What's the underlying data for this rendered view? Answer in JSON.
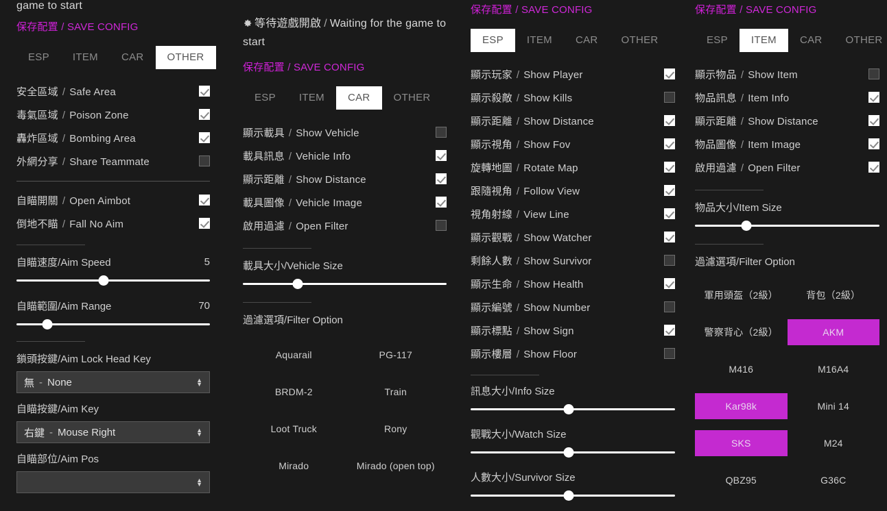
{
  "theme": {
    "background": "#1a1a1a",
    "accent": "#c42ad0",
    "save_link": "#cf28d8",
    "text": "#cfcfcf",
    "tab_active_bg": "#ffffff"
  },
  "status": {
    "cn": "等待遊戲開啟",
    "sep": "/",
    "en": "Waiting for the game to start",
    "icon": "gear-icon",
    "truncated_text": "game to start"
  },
  "save_config": {
    "cn": "保存配置",
    "sep": "/",
    "en": "SAVE CONFIG"
  },
  "tab_labels": [
    "ESP",
    "ITEM",
    "CAR",
    "OTHER"
  ],
  "panels": [
    {
      "id": "other-panel",
      "active_tab": "OTHER",
      "toggles": [
        {
          "cn": "安全區域",
          "en": "Safe Area",
          "checked": true
        },
        {
          "cn": "毒氣區域",
          "en": "Poison Zone",
          "checked": true
        },
        {
          "cn": "轟炸區域",
          "en": "Bombing Area",
          "checked": true
        },
        {
          "cn": "外網分享",
          "en": "Share Teammate",
          "checked": false
        }
      ],
      "toggles2": [
        {
          "cn": "自瞄開關",
          "en": "Open Aimbot",
          "checked": true
        },
        {
          "cn": "倒地不瞄",
          "en": "Fall No Aim",
          "checked": true
        }
      ],
      "sliders": [
        {
          "cn": "自瞄速度",
          "en": "Aim Speed",
          "value": "5",
          "percent": 45
        },
        {
          "cn": "自瞄範圍",
          "en": "Aim Range",
          "value": "70",
          "percent": 16
        }
      ],
      "selects": [
        {
          "label_cn": "鎖頭按鍵",
          "label_en": "Aim Lock Head Key",
          "value_cn": "無",
          "value_en": "None"
        },
        {
          "label_cn": "自瞄按鍵",
          "label_en": "Aim Key",
          "value_cn": "右鍵",
          "value_en": "Mouse Right"
        },
        {
          "label_cn": "自瞄部位",
          "label_en": "Aim Pos",
          "value_cn": "",
          "value_en": ""
        }
      ]
    },
    {
      "id": "car-panel",
      "active_tab": "CAR",
      "toggles": [
        {
          "cn": "顯示載具",
          "en": "Show Vehicle",
          "checked": false
        },
        {
          "cn": "載具訊息",
          "en": "Vehicle Info",
          "checked": true
        },
        {
          "cn": "顯示距離",
          "en": "Show Distance",
          "checked": true
        },
        {
          "cn": "載具圖像",
          "en": "Vehicle Image",
          "checked": true
        },
        {
          "cn": "啟用過濾",
          "en": "Open Filter",
          "checked": false
        }
      ],
      "size_slider": {
        "cn": "載具大小",
        "en": "Vehicle Size",
        "percent": 27
      },
      "filter_title": {
        "cn": "過濾選項",
        "en": "Filter Option"
      },
      "filter_items": [
        {
          "label": "Aquarail",
          "selected": false
        },
        {
          "label": "PG-117",
          "selected": false
        },
        {
          "label": "BRDM-2",
          "selected": false
        },
        {
          "label": "Train",
          "selected": false
        },
        {
          "label": "Loot Truck",
          "selected": false
        },
        {
          "label": "Rony",
          "selected": false
        },
        {
          "label": "Mirado",
          "selected": false
        },
        {
          "label": "Mirado (open top)",
          "selected": false
        }
      ]
    },
    {
      "id": "esp-panel",
      "active_tab": "ESP",
      "toggles": [
        {
          "cn": "顯示玩家",
          "en": "Show Player",
          "checked": true
        },
        {
          "cn": "顯示殺敵",
          "en": "Show Kills",
          "checked": false
        },
        {
          "cn": "顯示距離",
          "en": "Show Distance",
          "checked": true
        },
        {
          "cn": "顯示視角",
          "en": "Show Fov",
          "checked": true
        },
        {
          "cn": "旋轉地圖",
          "en": "Rotate Map",
          "checked": true
        },
        {
          "cn": "跟隨視角",
          "en": "Follow View",
          "checked": true
        },
        {
          "cn": "視角射線",
          "en": "View Line",
          "checked": true
        },
        {
          "cn": "顯示觀戰",
          "en": "Show Watcher",
          "checked": true
        },
        {
          "cn": "剩餘人數",
          "en": "Show Survivor",
          "checked": false
        },
        {
          "cn": "顯示生命",
          "en": "Show Health",
          "checked": true
        },
        {
          "cn": "顯示編號",
          "en": "Show Number",
          "checked": false
        },
        {
          "cn": "顯示標點",
          "en": "Show Sign",
          "checked": true
        },
        {
          "cn": "顯示樓層",
          "en": "Show Floor",
          "checked": false
        }
      ],
      "sliders": [
        {
          "cn": "訊息大小",
          "en": "Info Size",
          "percent": 48
        },
        {
          "cn": "觀戰大小",
          "en": "Watch Size",
          "percent": 48
        },
        {
          "cn": "人數大小",
          "en": "Survivor Size",
          "percent": 48
        }
      ]
    },
    {
      "id": "item-panel",
      "active_tab": "ITEM",
      "toggles": [
        {
          "cn": "顯示物品",
          "en": "Show Item",
          "checked": false
        },
        {
          "cn": "物品訊息",
          "en": "Item Info",
          "checked": true
        },
        {
          "cn": "顯示距離",
          "en": "Show Distance",
          "checked": true
        },
        {
          "cn": "物品圖像",
          "en": "Item Image",
          "checked": true
        },
        {
          "cn": "啟用過濾",
          "en": "Open Filter",
          "checked": true
        }
      ],
      "size_slider": {
        "cn": "物品大小",
        "en": "Item Size",
        "percent": 28
      },
      "filter_title": {
        "cn": "過濾選項",
        "en": "Filter Option"
      },
      "filter_items": [
        {
          "label": "軍用頭盔（2級）",
          "selected": false
        },
        {
          "label": "背包（2級）",
          "selected": false
        },
        {
          "label": "警察背心（2級）",
          "selected": false
        },
        {
          "label": "AKM",
          "selected": true
        },
        {
          "label": "M416",
          "selected": false
        },
        {
          "label": "M16A4",
          "selected": false
        },
        {
          "label": "Kar98k",
          "selected": true
        },
        {
          "label": "Mini 14",
          "selected": false
        },
        {
          "label": "SKS",
          "selected": true
        },
        {
          "label": "M24",
          "selected": false
        },
        {
          "label": "QBZ95",
          "selected": false
        },
        {
          "label": "G36C",
          "selected": false
        }
      ]
    }
  ]
}
